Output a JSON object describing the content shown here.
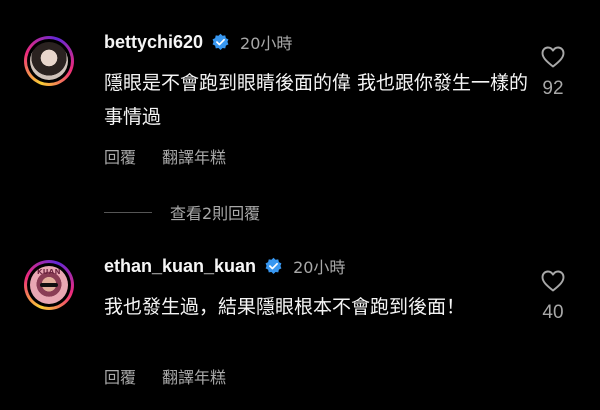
{
  "comments": [
    {
      "username": "bettychi620",
      "time": "20小時",
      "text": "隱眼是不會跑到眼睛後面的偉 我也跟你發生一樣的事情過",
      "reply_label": "回覆",
      "translate_label": "翻譯年糕",
      "likes": "92"
    },
    {
      "username": "ethan_kuan_kuan",
      "time": "20小時",
      "text": "我也發生過，結果隱眼根本不會跑到後面！",
      "reply_label": "回覆",
      "translate_label": "翻譯年糕",
      "likes": "40",
      "avatar_text": "KUAN"
    }
  ],
  "view_replies": "查看2則回覆",
  "icons": {
    "verified": "verified-badge-icon",
    "like": "heart-icon"
  },
  "colors": {
    "background": "#000000",
    "verified": "#3897f0",
    "secondary_text": "#a8a8a8"
  }
}
